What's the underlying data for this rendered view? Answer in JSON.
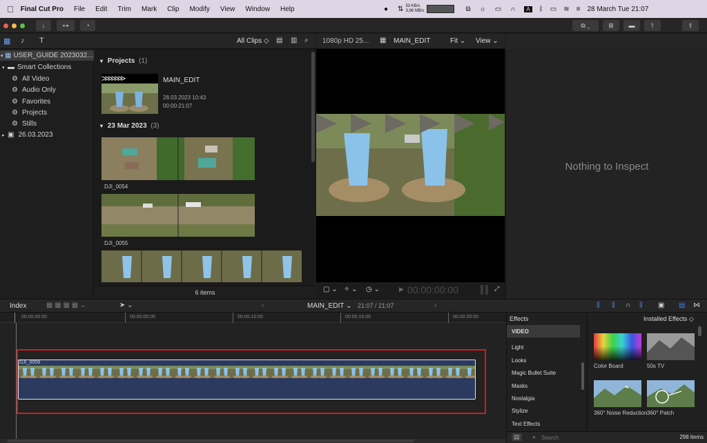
{
  "menubar": {
    "app": "Final Cut Pro",
    "items": [
      "File",
      "Edit",
      "Trim",
      "Mark",
      "Clip",
      "Modify",
      "View",
      "Window",
      "Help"
    ],
    "net_up": "53 KB/s",
    "net_down": "3,98 MB/s",
    "datetime": "28 March Tue  21:07"
  },
  "browser_bar": {
    "filter": "All Clips ◇"
  },
  "viewer_bar": {
    "format": "1080p HD 25...",
    "project": "MAIN_EDIT",
    "fit": "Fit ⌄",
    "view": "View ⌄"
  },
  "sidebar": {
    "library": "USER_GUIDE 2023032...",
    "smart_collections": "Smart Collections",
    "collections": [
      "All Video",
      "Audio Only",
      "Favorites",
      "Projects",
      "Stills"
    ],
    "event": "26.03.2023"
  },
  "browser": {
    "projects_header": "Projects",
    "projects_count": "(1)",
    "project_name": "MAIN_EDIT",
    "project_date": "28.03.2023 10:43",
    "project_duration": "00:00:21:07",
    "event_header": "23 Mar 2023",
    "event_count": "(3)",
    "clip1": "DJI_0054",
    "clip2": "DJI_0055",
    "items_count": "6 items"
  },
  "viewer": {
    "timecode": "00:00:00:00"
  },
  "inspector": {
    "empty_text": "Nothing to Inspect"
  },
  "timeline_head": {
    "index": "Index",
    "project": "MAIN_EDIT ⌄",
    "duration": "21:07 / 21:07"
  },
  "ruler": [
    "00:00:00:00",
    "00:00:05:00",
    "00:00:10:00",
    "00:00:15:00",
    "00:00:20:00"
  ],
  "timeline": {
    "clip_name": "DJI_0059"
  },
  "effects": {
    "title": "Effects",
    "installed": "Installed Effects ◇",
    "categories": [
      "VIDEO",
      "Light",
      "Looks",
      "Magic Bullet Suite",
      "Masks",
      "Nostalgia",
      "Stylize",
      "Text Effects"
    ],
    "thumbs": [
      "Color Board",
      "50s TV",
      "360° Noise Reduction",
      "360° Patch"
    ],
    "search_placeholder": "Search",
    "count": "298 items"
  },
  "colors": {
    "accent": "#4a7bd8",
    "clip_fill": "#2b3a5e",
    "selection": "#d11d1d"
  }
}
